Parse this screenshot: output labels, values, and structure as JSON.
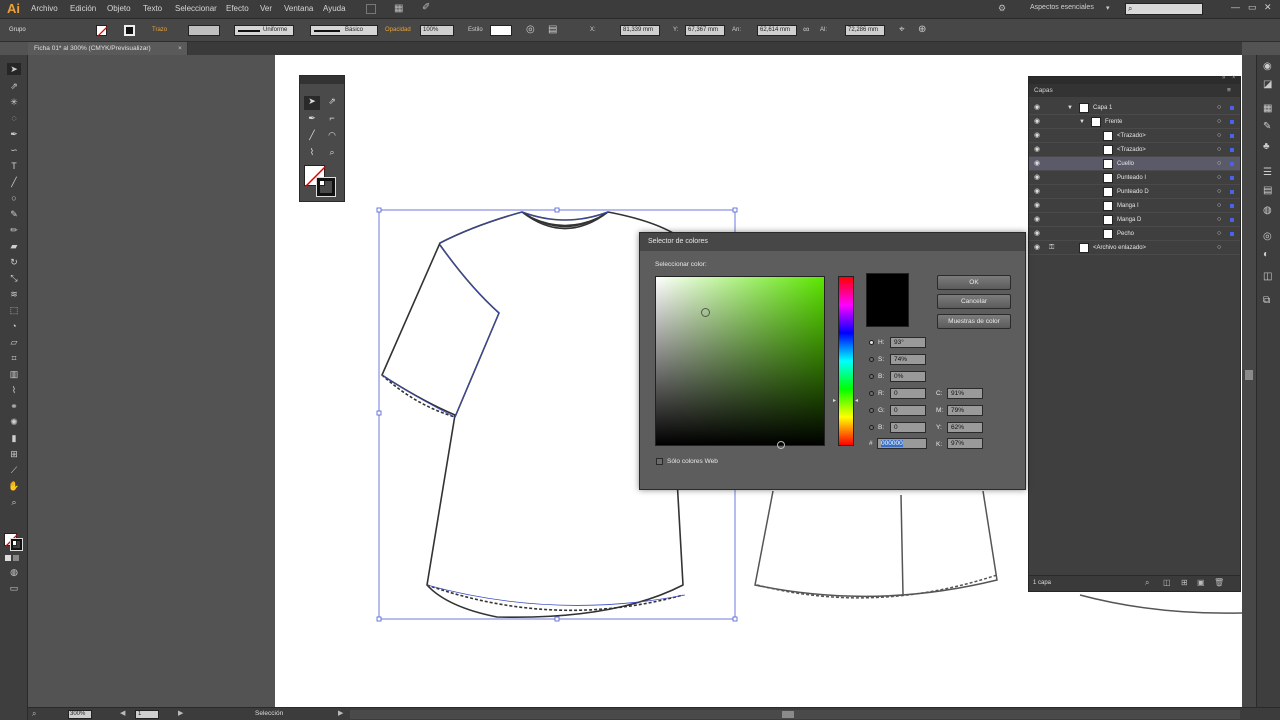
{
  "app": {
    "logo": "Ai"
  },
  "menu": [
    "Archivo",
    "Edición",
    "Objeto",
    "Texto",
    "Seleccionar",
    "Efecto",
    "Ver",
    "Ventana",
    "Ayuda"
  ],
  "workspace": {
    "label": "Aspectos esenciales",
    "search_placeholder": ""
  },
  "control_bar": {
    "selection_label": "Grupo",
    "stroke_label": "Trazo",
    "stroke_profile": "Uniforme",
    "brush": "Básico",
    "opacity_label": "Opacidad",
    "opacity": "100%",
    "style_label": "Estilo",
    "x_label": "X:",
    "x": "81,339 mm",
    "y_label": "Y:",
    "y": "67,367 mm",
    "w_label": "An:",
    "w": "62,614 mm",
    "h_label": "Al:",
    "h": "72,286 mm"
  },
  "document": {
    "tab": "Ficha 01* al 300% (CMYK/Previsualizar)"
  },
  "layers_panel": {
    "title": "Capas",
    "footer": "1 capa",
    "rows": [
      {
        "name": "Capa 1",
        "indent": 0,
        "selected": false
      },
      {
        "name": "Frente",
        "indent": 1,
        "selected": false
      },
      {
        "name": "<Trazado>",
        "indent": 2,
        "selected": false
      },
      {
        "name": "<Trazado>",
        "indent": 2,
        "selected": false
      },
      {
        "name": "Cuello",
        "indent": 2,
        "selected": true
      },
      {
        "name": "Punteado I",
        "indent": 2,
        "selected": false
      },
      {
        "name": "Punteado D",
        "indent": 2,
        "selected": false
      },
      {
        "name": "Manga I",
        "indent": 2,
        "selected": false
      },
      {
        "name": "Manga D",
        "indent": 2,
        "selected": false
      },
      {
        "name": "Pecho",
        "indent": 2,
        "selected": false
      },
      {
        "name": "<Archivo enlazado>",
        "indent": 0,
        "selected": false
      }
    ]
  },
  "color_picker": {
    "title": "Selector de colores",
    "select_label": "Seleccionar color:",
    "ok": "OK",
    "cancel": "Cancelar",
    "swatches": "Muestras de color",
    "web_only": "Sólo colores Web",
    "h_label": "H:",
    "h": "93°",
    "s_label": "S:",
    "s": "74%",
    "b_label": "B:",
    "b": "0%",
    "r_label": "R:",
    "r": "0",
    "g_label": "G:",
    "g": "0",
    "bl_label": "B:",
    "bl": "0",
    "hex_label": "#",
    "hex": "000000",
    "c_label": "C:",
    "c": "91%",
    "m_label": "M:",
    "m": "79%",
    "y_label": "Y:",
    "y": "62%",
    "k_label": "K:",
    "k": "97%",
    "hue_color": "#5ce600",
    "current_color": "#000000"
  },
  "status_bar": {
    "zoom": "300%",
    "page": "1",
    "tool": "Selección"
  }
}
